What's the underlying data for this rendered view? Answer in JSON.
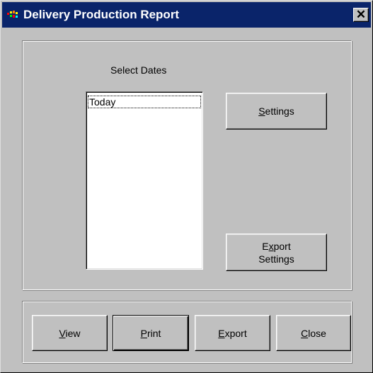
{
  "window": {
    "title": "Delivery Production Report",
    "close_glyph": "✕",
    "app_icon": "report-app-icon"
  },
  "dates": {
    "label": "Select Dates",
    "items": [
      "Today"
    ],
    "selected": "Today"
  },
  "buttons": {
    "settings": {
      "mnemonic": "S",
      "rest": "ettings"
    },
    "export_settings": {
      "line1_pre": "E",
      "line1_mn": "x",
      "line1_post": "port",
      "line2": "Settings"
    },
    "view": {
      "mnemonic": "V",
      "rest": "iew"
    },
    "print": {
      "mnemonic": "P",
      "rest": "rint"
    },
    "export": {
      "mnemonic": "E",
      "rest": "xport"
    },
    "close": {
      "mnemonic": "C",
      "rest": "lose"
    }
  },
  "colors": {
    "titlebar": "#0a246a",
    "face": "#c0c0c0"
  }
}
